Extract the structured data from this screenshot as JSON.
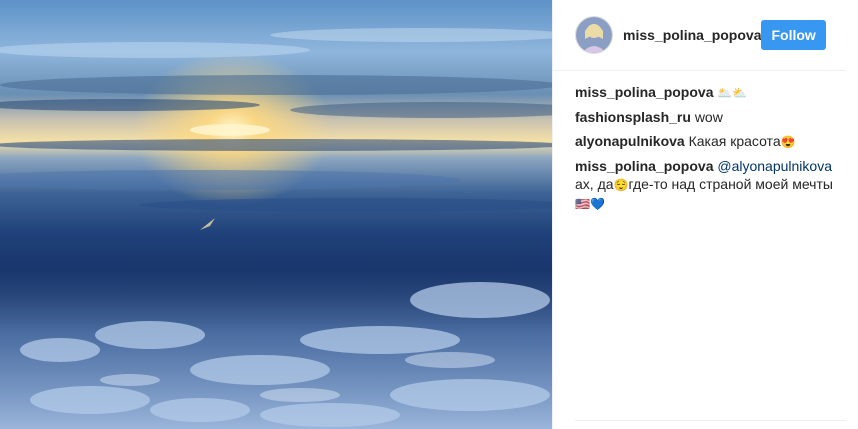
{
  "post": {
    "username": "miss_polina_popova",
    "follow_label": "Follow",
    "accent": "#3897f0",
    "mention_color": "#003569"
  },
  "comments": [
    {
      "user": "miss_polina_popova",
      "text": "",
      "emoji": "🌥️⛅"
    },
    {
      "user": "fashionsplash_ru",
      "text": "wow"
    },
    {
      "user": "alyonapulnikova",
      "text": "Какая красота",
      "emoji": "😍"
    },
    {
      "user": "miss_polina_popova",
      "mention": "@alyonapulnikova",
      "text_a": "ах, да",
      "emoji_a": "😌",
      "text_b": "где-то над страной моей мечты",
      "emoji_b": "🇺🇸💙"
    }
  ]
}
